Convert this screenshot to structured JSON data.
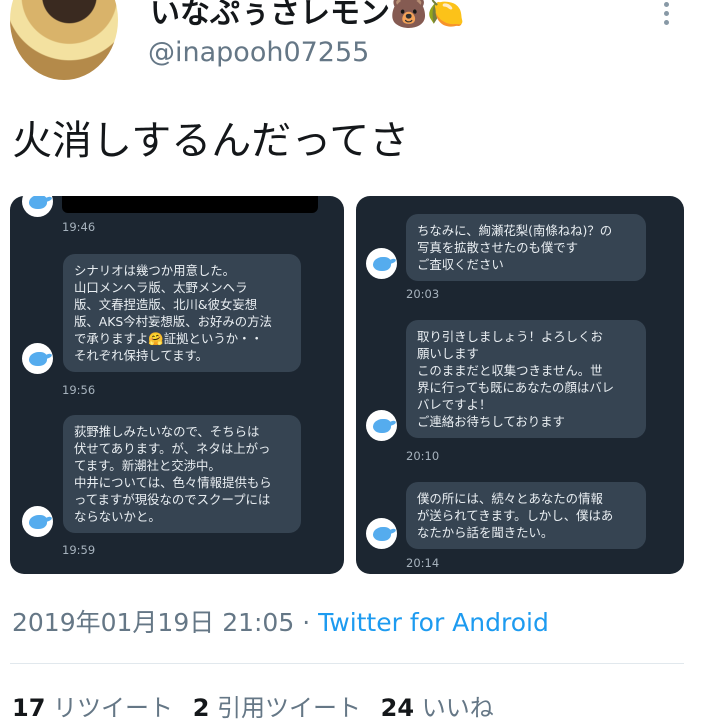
{
  "header": {
    "display_name": "いなぷぅさレモン🐻🍋",
    "handle": "@inapooh07255"
  },
  "tweet": {
    "text": "火消しするんだってさ"
  },
  "left_panel": {
    "messages": [
      {
        "time": "19:46"
      },
      {
        "text": "シナリオは幾つか用意した。\n山口メンヘラ版、太野メンヘラ\n版、文春捏造版、北川&彼女妄想\n版、AKS今村妄想版、お好みの方法\nで承りますよ🤗証拠というか・・\nそれぞれ保持してます。",
        "time": "19:56"
      },
      {
        "text": "荻野推しみたいなので、そちらは\n伏せてあります。が、ネタは上がっ\nてます。新潮社と交渉中。\n中井については、色々情報提供もら\nってますが現役なのでスクープには\nならないかと。",
        "time": "19:59"
      }
    ]
  },
  "right_panel": {
    "messages": [
      {
        "text": "ちなみに、絢瀬花梨(南條ねね)？の\n写真を拡散させたのも僕です\nご査収ください",
        "time": "20:03"
      },
      {
        "text": "取り引きしましょう！よろしくお\n願いします\nこのままだと収集つきません。世\n界に行っても既にあなたの顔はバレ\nバレですよ！\nご連絡お待ちしております",
        "time": "20:10"
      },
      {
        "text": "僕の所には、続々とあなたの情報\nが送られてきます。しかし、僕はあ\nなたから話を聞きたい。",
        "time": "20:14"
      }
    ]
  },
  "footer": {
    "timestamp": "2019年01月19日 21:05",
    "separator": "·",
    "source": "Twitter for Android"
  },
  "stats": {
    "retweets_count": "17",
    "retweets_label": "リツイート",
    "quotes_count": "2",
    "quotes_label": "引用ツイート",
    "likes_count": "24",
    "likes_label": "いいね"
  },
  "colors": {
    "panel_bg": "#1c2631",
    "bubble_bg": "#364452",
    "link": "#1d9bf0"
  },
  "icons": [
    "more-vertical-icon",
    "twitter-bird-icon"
  ]
}
